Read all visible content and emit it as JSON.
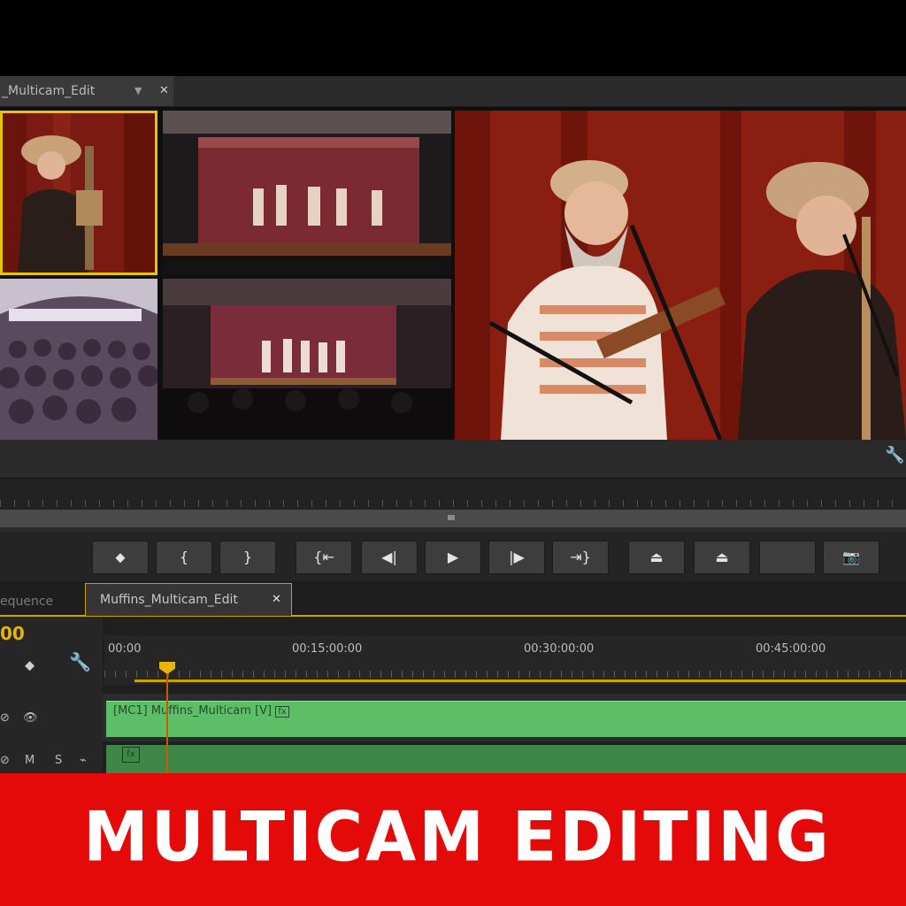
{
  "colors": {
    "accent": "#e8b400",
    "banner": "#e40a0a",
    "clip_video": "#5cbf68",
    "clip_audio": "#3f8748"
  },
  "monitor": {
    "tab_label": "_Multicam_Edit",
    "tab_menu_icon": "chevron-down-icon",
    "tab_close": "✕",
    "active_camera": 1,
    "cameras": [
      "camera-1-angle",
      "camera-2-angle",
      "camera-3-angle",
      "camera-4-angle"
    ]
  },
  "transport": {
    "buttons": [
      {
        "name": "add-marker-button",
        "icon": "marker-icon",
        "glyph": "⬥"
      },
      {
        "name": "mark-in-button",
        "icon": "mark-in-icon",
        "glyph": "{"
      },
      {
        "name": "mark-out-button",
        "icon": "mark-out-icon",
        "glyph": "}"
      },
      {
        "name": "go-to-in-button",
        "icon": "go-to-in-icon",
        "glyph": "{⇤"
      },
      {
        "name": "step-back-button",
        "icon": "step-back-icon",
        "glyph": "◀|"
      },
      {
        "name": "play-button",
        "icon": "play-icon",
        "glyph": "▶"
      },
      {
        "name": "step-forward-button",
        "icon": "step-forward-icon",
        "glyph": "|▶"
      },
      {
        "name": "go-to-out-button",
        "icon": "go-to-out-icon",
        "glyph": "⇥}"
      },
      {
        "name": "lift-button",
        "icon": "lift-icon",
        "glyph": "⏏"
      },
      {
        "name": "extract-button",
        "icon": "extract-icon",
        "glyph": "⏏"
      },
      {
        "name": "toggle-multicam-button",
        "icon": "multicam-icon",
        "glyph": ""
      },
      {
        "name": "export-frame-button",
        "icon": "camera-icon",
        "glyph": "📷"
      }
    ]
  },
  "timeline": {
    "tab_sequence_label": "equence",
    "tab_active_label": "Muffins_Multicam_Edit",
    "tab_close": "✕",
    "timecode": "00",
    "ruler_labels": [
      "00:00",
      "00:15:00:00",
      "00:30:00:00",
      "00:45:00:00"
    ],
    "video_clip_label": "[MC1] Muffins_Multicam [V]",
    "fx_badge": "fx",
    "audio_controls": [
      "M",
      "S"
    ]
  },
  "banner": {
    "text": "MULTICAM EDITING"
  }
}
